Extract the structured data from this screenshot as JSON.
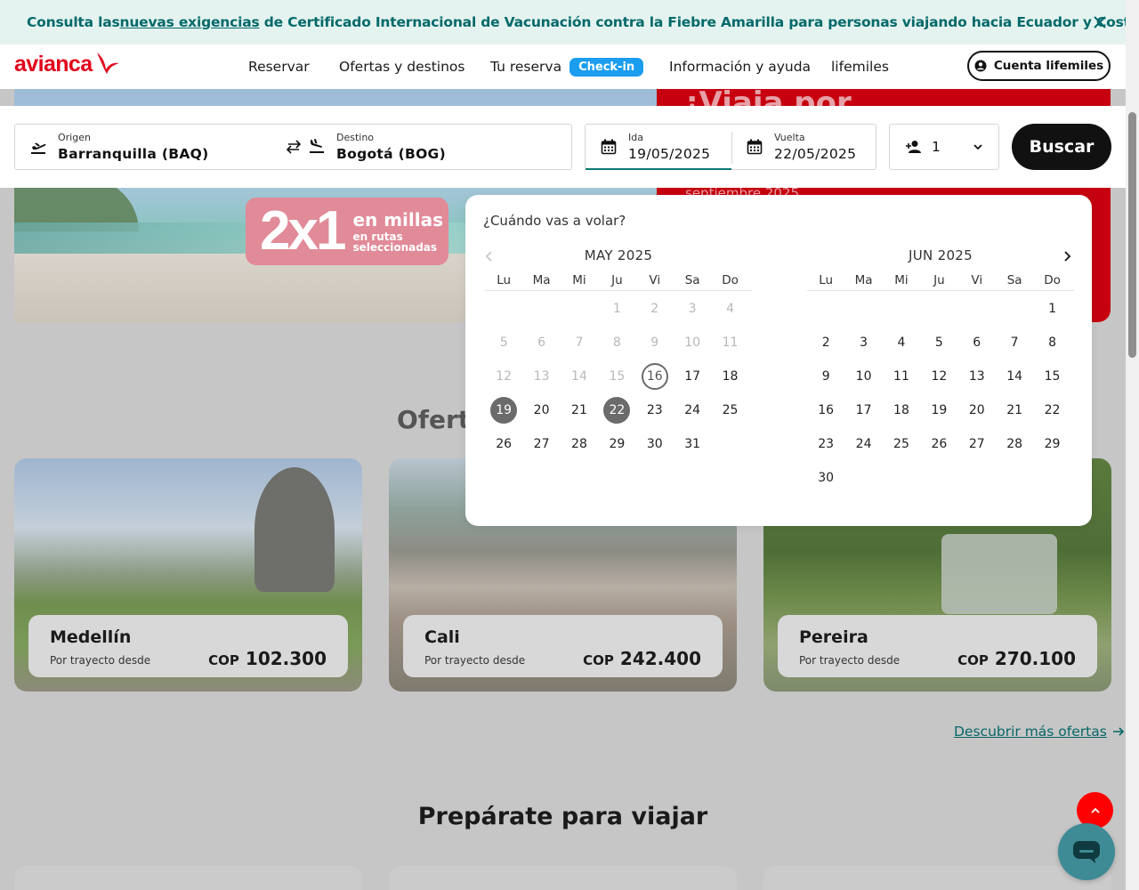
{
  "alert": {
    "prefix": "Consulta las",
    "link": "nuevas exigencias",
    "suffix": "de Certificado Internacional de Vacunación contra la Fiebre Amarilla para personas viajando hacia Ecuador y Costa Rica."
  },
  "header": {
    "logo": "avianca",
    "nav": [
      "Reservar",
      "Ofertas y destinos",
      "Tu reserva",
      "Información y ayuda",
      "lifemiles"
    ],
    "checkin_badge": "Check-in",
    "account_button": "Cuenta lifemiles"
  },
  "hero": {
    "promo_big": "2x1",
    "promo_line1": "en millas",
    "promo_line2": "en rutas seleccionadas",
    "red_heading": "¡Viaja por",
    "red_sub": "septiembre 2025"
  },
  "search": {
    "origin_label": "Origen",
    "origin_value": "Barranquilla  (BAQ)",
    "destination_label": "Destino",
    "destination_value": "Bogotá  (BOG)",
    "depart_label": "Ida",
    "depart_value": "19/05/2025",
    "return_label": "Vuelta",
    "return_value": "22/05/2025",
    "passengers": "1",
    "button": "Buscar"
  },
  "calendar": {
    "title": "¿Cuándo vas a volar?",
    "weekdays": [
      "Lu",
      "Ma",
      "Mi",
      "Ju",
      "Vi",
      "Sa",
      "Do"
    ],
    "months": [
      {
        "title": "MAY 2025",
        "offset": 3,
        "days": 31,
        "disabled_until": 16,
        "today": 16,
        "selected": [
          19,
          22
        ]
      },
      {
        "title": "JUN 2025",
        "offset": 6,
        "days": 30,
        "disabled_until": 0,
        "today": null,
        "selected": []
      }
    ]
  },
  "offers": {
    "title_partial": "Oferta",
    "cards": [
      {
        "city": "Medellín",
        "from": "Por trayecto desde",
        "currency": "COP",
        "price": "102.300"
      },
      {
        "city": "Cali",
        "from": "Por trayecto desde",
        "currency": "COP",
        "price": "242.400"
      },
      {
        "city": "Pereira",
        "from": "Por trayecto desde",
        "currency": "COP",
        "price": "270.100"
      }
    ],
    "more_link": "Descubrir más ofertas"
  },
  "prepare": {
    "title": "Prepárate para viajar"
  },
  "colors": {
    "brand_red": "#e1001a",
    "teal": "#04696a",
    "checkin_blue": "#1b9df0",
    "selected_day": "#6b6b6b"
  }
}
